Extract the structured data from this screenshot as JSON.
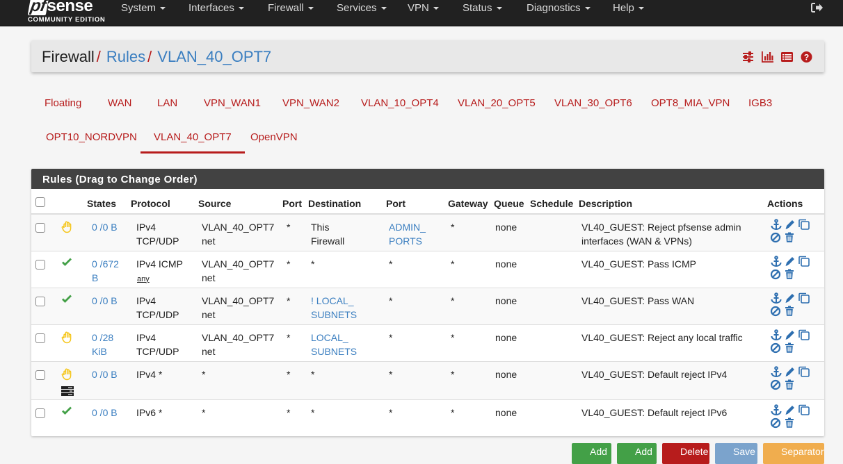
{
  "brand": {
    "logo_pf": "pf",
    "logo_sense": "sense",
    "subtitle": "COMMUNITY EDITION"
  },
  "nav": {
    "items": [
      {
        "label": "System"
      },
      {
        "label": "Interfaces"
      },
      {
        "label": "Firewall"
      },
      {
        "label": "Services"
      },
      {
        "label": "VPN"
      },
      {
        "label": "Status"
      },
      {
        "label": "Diagnostics"
      },
      {
        "label": "Help"
      }
    ],
    "logout_icon": "sign-out-icon"
  },
  "breadcrumb": {
    "root": "Firewall",
    "sep": "/",
    "level2": "Rules",
    "level3": "VLAN_40_OPT7",
    "icons": [
      "sliders-icon",
      "bar-chart-icon",
      "list-alt-icon",
      "question-circle-icon"
    ]
  },
  "tabs": [
    {
      "label": "Floating"
    },
    {
      "label": "WAN"
    },
    {
      "label": "LAN"
    },
    {
      "label": "VPN_WAN1"
    },
    {
      "label": "VPN_WAN2"
    },
    {
      "label": "VLAN_10_OPT4"
    },
    {
      "label": "VLAN_20_OPT5"
    },
    {
      "label": "VLAN_30_OPT6"
    },
    {
      "label": "OPT8_MIA_VPN"
    },
    {
      "label": "IGB3"
    },
    {
      "label": "OPT10_NORDVPN"
    },
    {
      "label": "VLAN_40_OPT7",
      "active": true
    },
    {
      "label": "OpenVPN"
    }
  ],
  "panel": {
    "title": "Rules (Drag to Change Order)",
    "columns": [
      "",
      "",
      "States",
      "Protocol",
      "Source",
      "Port",
      "Destination",
      "Port",
      "Gateway",
      "Queue",
      "Schedule",
      "Description",
      "Actions"
    ],
    "rows": [
      {
        "action": "reject",
        "states": "0 /0 B",
        "protocol": "IPv4 TCP/UDP",
        "protocol_sub": "",
        "source": "VLAN_40_OPT7 net",
        "src_port": "*",
        "destination": "This Firewall",
        "dest_link": false,
        "dest_port": "ADMIN_ PORTS",
        "dest_port_link": true,
        "gateway": "*",
        "queue": "none",
        "schedule": "",
        "description": "VL40_GUEST: Reject pfsense admin interfaces (WAN & VPNs)"
      },
      {
        "action": "pass",
        "states": "0 /672 B",
        "protocol": "IPv4 ICMP",
        "protocol_sub": "any",
        "source": "VLAN_40_OPT7 net",
        "src_port": "*",
        "destination": "*",
        "dest_link": false,
        "dest_port": "*",
        "dest_port_link": false,
        "gateway": "*",
        "queue": "none",
        "schedule": "",
        "description": "VL40_GUEST: Pass ICMP"
      },
      {
        "action": "pass",
        "states": "0 /0 B",
        "protocol": "IPv4 TCP/UDP",
        "protocol_sub": "",
        "source": "VLAN_40_OPT7 net",
        "src_port": "*",
        "destination": "! LOCAL_ SUBNETS",
        "dest_link": true,
        "dest_port": "*",
        "dest_port_link": false,
        "gateway": "*",
        "queue": "none",
        "schedule": "",
        "description": "VL40_GUEST: Pass WAN"
      },
      {
        "action": "reject",
        "states": "0 /28 KiB",
        "protocol": "IPv4 TCP/UDP",
        "protocol_sub": "",
        "source": "VLAN_40_OPT7 net",
        "src_port": "*",
        "destination": "LOCAL_ SUBNETS",
        "dest_link": true,
        "dest_port": "*",
        "dest_port_link": false,
        "gateway": "*",
        "queue": "none",
        "schedule": "",
        "description": "VL40_GUEST: Reject any local traffic"
      },
      {
        "action": "reject",
        "log": true,
        "states": "0 /0 B",
        "protocol": "IPv4 *",
        "protocol_sub": "",
        "source": "*",
        "src_port": "*",
        "destination": "*",
        "dest_link": false,
        "dest_port": "*",
        "dest_port_link": false,
        "gateway": "*",
        "queue": "none",
        "schedule": "",
        "description": "VL40_GUEST: Default reject IPv4"
      },
      {
        "action": "pass",
        "states": "0 /0 B",
        "protocol": "IPv6 *",
        "protocol_sub": "",
        "source": "*",
        "src_port": "*",
        "destination": "*",
        "dest_link": false,
        "dest_port": "*",
        "dest_port_link": false,
        "gateway": "*",
        "queue": "none",
        "schedule": "",
        "description": "VL40_GUEST: Default reject IPv6"
      }
    ],
    "row_action_icons": [
      "anchor-icon",
      "pencil-icon",
      "copy-icon",
      "disable-icon",
      "trash-icon"
    ]
  },
  "buttons": [
    {
      "label": "Add",
      "color": "#43a047"
    },
    {
      "label": "Add",
      "color": "#43a047"
    },
    {
      "label": "Delete",
      "color": "#b71c1c"
    },
    {
      "label": "Save",
      "color": "#7ba3cc"
    },
    {
      "label": "Separator",
      "color": "#f0ad4e"
    }
  ],
  "colors": {
    "accent_red": "#b71c1c",
    "link_blue": "#3a7ec0",
    "pass_green": "#43a047",
    "reject_yellow": "#f5c518",
    "navbar": "#212121",
    "panel_head": "#424242"
  }
}
